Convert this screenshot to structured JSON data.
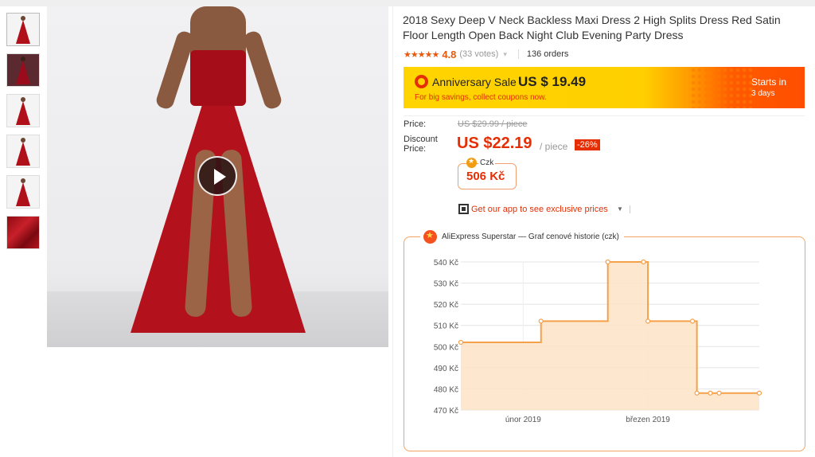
{
  "thumbnails": [
    {
      "alt": "dress front"
    },
    {
      "alt": "dress back"
    },
    {
      "alt": "dress detail"
    },
    {
      "alt": "dress side"
    },
    {
      "alt": "dress closeup"
    },
    {
      "alt": "fabric"
    }
  ],
  "product": {
    "title": "2018 Sexy Deep V Neck Backless Maxi Dress 2 High Splits Dress Red Satin Floor Length Open Back Night Club Evening Party Dress",
    "stars": "★★★★★",
    "rating": "4.8",
    "votes": "(33 votes)",
    "orders": "136 orders"
  },
  "banner": {
    "label": "Anniversary Sale",
    "price": "US $ 19.49",
    "sub": "For big savings, collect coupons now.",
    "starts_label": "Starts in",
    "starts_days": "3 days"
  },
  "pricing": {
    "price_label": "Price:",
    "old_price": "US $29.99 / piece",
    "discount_label_1": "Discount",
    "discount_label_2": "Price:",
    "new_price": "US $22.19",
    "per_piece": "/ piece",
    "discount": "-26%",
    "czk_currency": "Czk",
    "czk_value": "506 Kč"
  },
  "app_promo": {
    "text": "Get our app to see exclusive prices"
  },
  "chart_widget": {
    "title": "AliExpress Superstar — Graf cenové historie (czk)"
  },
  "chart_data": {
    "type": "area",
    "step": true,
    "title": "AliExpress Superstar — Graf cenové historie (czk)",
    "x": [
      "2019-01-18",
      "2019-02-05",
      "2019-02-05",
      "2019-02-20",
      "2019-02-20",
      "2019-03-01",
      "2019-03-01",
      "2019-03-12",
      "2019-03-12",
      "2019-03-15",
      "2019-03-17",
      "2019-03-26"
    ],
    "y": [
      502,
      502,
      512,
      512,
      540,
      540,
      512,
      512,
      478,
      478,
      478,
      478
    ],
    "points": [
      {
        "x": "2019-01-18",
        "y": 502
      },
      {
        "x": "2019-02-05",
        "y": 512
      },
      {
        "x": "2019-02-20",
        "y": 540
      },
      {
        "x": "2019-02-28",
        "y": 540
      },
      {
        "x": "2019-03-01",
        "y": 512
      },
      {
        "x": "2019-03-11",
        "y": 512
      },
      {
        "x": "2019-03-12",
        "y": 478
      },
      {
        "x": "2019-03-15",
        "y": 478
      },
      {
        "x": "2019-03-17",
        "y": 478
      },
      {
        "x": "2019-03-26",
        "y": 478
      }
    ],
    "x_tick_dates": [
      "2019-02-01",
      "2019-03-01"
    ],
    "x_ticks": [
      "únor 2019",
      "březen 2019"
    ],
    "y_ticks": [
      "470 Kč",
      "480 Kč",
      "490 Kč",
      "500 Kč",
      "510 Kč",
      "520 Kč",
      "530 Kč",
      "540 Kč"
    ],
    "ylim": [
      470,
      540
    ],
    "xlim": [
      "2019-01-18",
      "2019-03-26"
    ],
    "grid": true,
    "line_color": "#f5a04a",
    "fill_color": "#fde3c6"
  }
}
